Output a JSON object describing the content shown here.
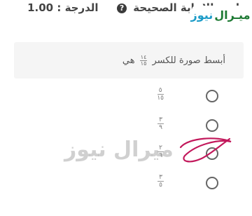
{
  "header": {
    "grade_label": "الدرجة : 1.00",
    "instruction": "اختر الإجابة الصحيحة",
    "help_icon": "question-circle-icon"
  },
  "logo": {
    "text_main": "ميـرال",
    "text_tail": "نيوز",
    "colors": {
      "main": "#1e7a34",
      "tail": "#1d9cc8"
    }
  },
  "question": {
    "prefix": "أبسط صورة للكسر",
    "fraction": {
      "numerator": "١٤",
      "denominator": "١٥"
    },
    "suffix": "هي"
  },
  "options": [
    {
      "numerator": "٥",
      "denominator": "١٥"
    },
    {
      "numerator": "٣",
      "denominator": "٩"
    },
    {
      "numerator": "٢",
      "denominator": "٦"
    },
    {
      "numerator": "٣",
      "denominator": "٥"
    }
  ],
  "watermark": "ميرال نيوز"
}
